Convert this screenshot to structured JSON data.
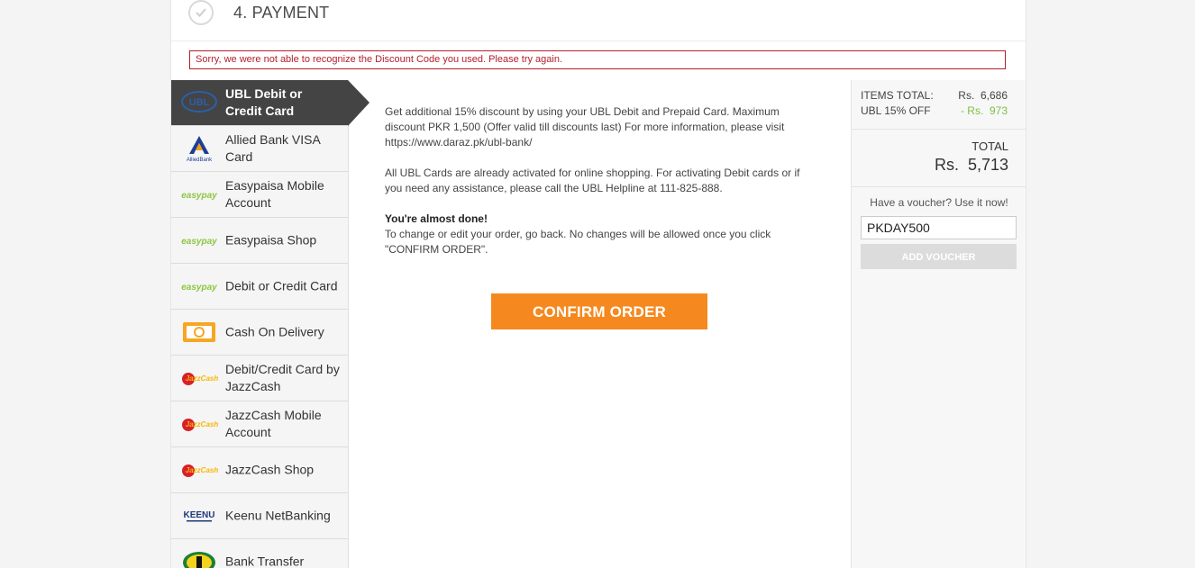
{
  "step": {
    "title": "4. PAYMENT"
  },
  "error_message": "Sorry, we were not able to recognize the Discount Code you used. Please try again.",
  "methods": [
    {
      "label": "UBL Debit or Credit Card",
      "icon": "ubl-logo-icon",
      "active": true
    },
    {
      "label": "Allied Bank VISA Card",
      "icon": "allied-bank-logo-icon"
    },
    {
      "label": "Easypaisa Mobile Account",
      "icon": "easypay-logo-icon"
    },
    {
      "label": "Easypaisa Shop",
      "icon": "easypay-logo-icon"
    },
    {
      "label": "Debit or Credit Card",
      "icon": "easypay-logo-icon"
    },
    {
      "label": "Cash On Delivery",
      "icon": "cash-icon"
    },
    {
      "label": "Debit/Credit Card by JazzCash",
      "icon": "jazzcash-logo-icon"
    },
    {
      "label": "JazzCash Mobile Account",
      "icon": "jazzcash-logo-icon"
    },
    {
      "label": "JazzCash Shop",
      "icon": "jazzcash-logo-icon"
    },
    {
      "label": "Keenu NetBanking",
      "icon": "keenu-logo-icon"
    },
    {
      "label": "Bank Transfer",
      "icon": "bank-transfer-icon"
    }
  ],
  "logos": {
    "ubl": "UBL",
    "allied": "AlliedBank",
    "easypay": "easypay",
    "jazzcash": "JazzCash",
    "keenu": "KEENU"
  },
  "content": {
    "para1": "Get additional 15% discount by using your UBL Debit and Prepaid Card. Maximum discount PKR 1,500 (Offer valid till discounts last) For more information, please visit https://www.daraz.pk/ubl-bank/",
    "para2": "All UBL Cards are already activated for online shopping. For activating Debit cards or if you need any assistance, please call the UBL Helpline at 111-825-888.",
    "almost_done": "You're almost done!",
    "para3": "To change or edit your order, go back. No changes will be allowed once you click \"CONFIRM ORDER\".",
    "confirm_label": "CONFIRM ORDER"
  },
  "summary": {
    "items_total_label": "ITEMS TOTAL:",
    "items_total_value": "Rs.  6,686",
    "discount_label": "UBL 15% OFF",
    "discount_value": "- Rs.  973",
    "total_label": "TOTAL",
    "total_value": "Rs.  5,713",
    "voucher_hint": "Have a voucher? Use it now!",
    "voucher_value": "PKDAY500",
    "voucher_button": "ADD VOUCHER"
  },
  "colors": {
    "accent": "#f5891f",
    "error": "#b51e2c",
    "discount": "#7ac143",
    "active_tab": "#444444"
  }
}
